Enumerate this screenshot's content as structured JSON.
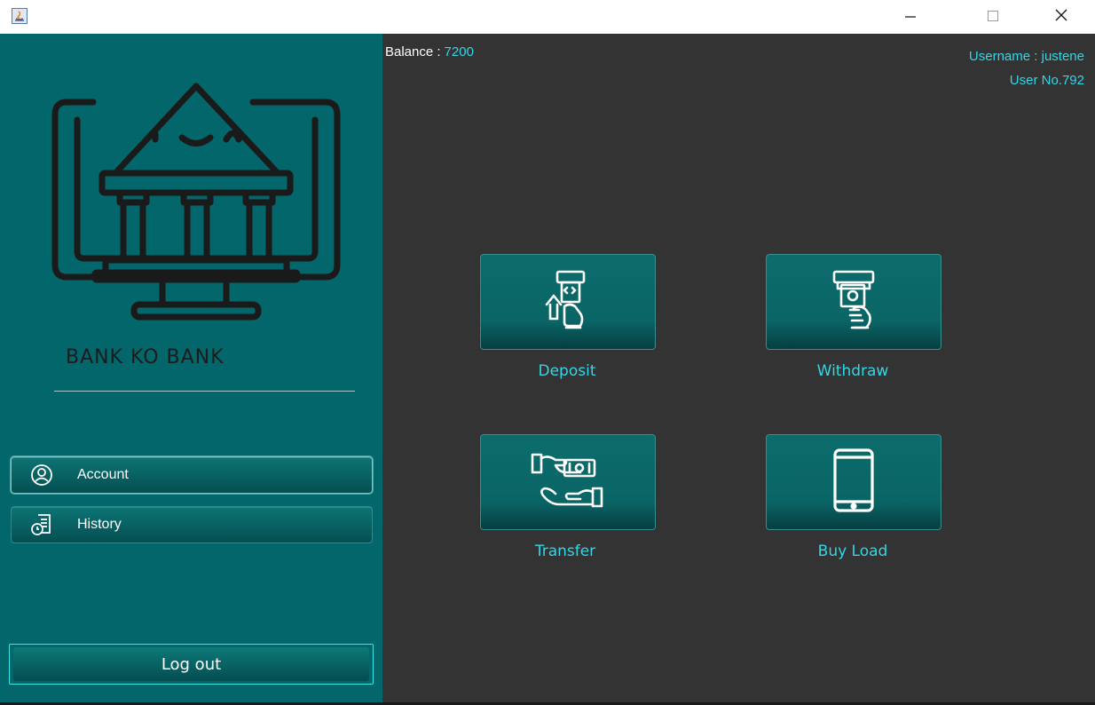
{
  "window": {
    "icon": "java-app-icon",
    "controls": [
      "minimize-icon",
      "maximize-icon",
      "close-icon"
    ]
  },
  "sidebar": {
    "logo": "bank-monitor-logo",
    "bank_name": "BANK KO BANK",
    "items": [
      {
        "label": "Account",
        "icon": "user-circle-icon"
      },
      {
        "label": "History",
        "icon": "history-document-icon"
      }
    ],
    "logout_label": "Log out"
  },
  "header": {
    "balance_label": "Balance :",
    "balance_value": "7200",
    "username": "Username : justene",
    "user_no": "User No.792"
  },
  "actions": [
    {
      "label": "Deposit",
      "icon": "atm-deposit-icon"
    },
    {
      "label": "Withdraw",
      "icon": "atm-withdraw-icon"
    },
    {
      "label": "Transfer",
      "icon": "money-transfer-icon"
    },
    {
      "label": "Buy Load",
      "icon": "mobile-phone-icon"
    }
  ],
  "colors": {
    "sidebar_bg": "#03666a",
    "main_bg": "#333333",
    "accent_cyan": "#33d6e6",
    "button_teal": "#0c6c6c"
  }
}
